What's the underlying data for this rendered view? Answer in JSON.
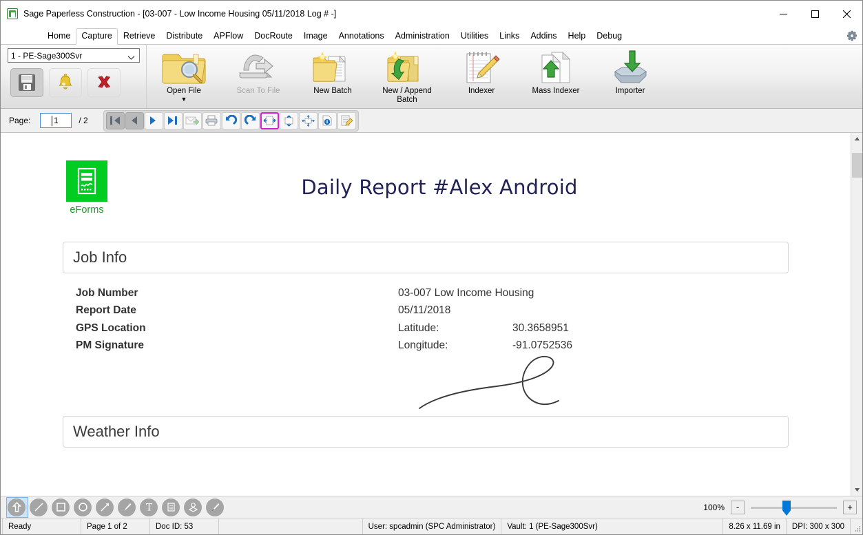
{
  "window": {
    "title": "Sage Paperless Construction - [03-007 - Low Income Housing 05/11/2018 Log # -]",
    "minimize_label": "—",
    "maximize_label": "☐",
    "close_label": "✕"
  },
  "menu": {
    "items": [
      {
        "label": "Home",
        "active": false
      },
      {
        "label": "Capture",
        "active": true
      },
      {
        "label": "Retrieve",
        "active": false
      },
      {
        "label": "Distribute",
        "active": false
      },
      {
        "label": "APFlow",
        "active": false
      },
      {
        "label": "DocRoute",
        "active": false
      },
      {
        "label": "Image",
        "active": false
      },
      {
        "label": "Annotations",
        "active": false
      },
      {
        "label": "Administration",
        "active": false
      },
      {
        "label": "Utilities",
        "active": false
      },
      {
        "label": "Links",
        "active": false
      },
      {
        "label": "Addins",
        "active": false
      },
      {
        "label": "Help",
        "active": false
      },
      {
        "label": "Debug",
        "active": false
      }
    ],
    "settings_icon": "gear-icon"
  },
  "ribbon": {
    "vault_value": "1 - PE-Sage300Svr",
    "quick_buttons": [
      {
        "name": "save-button",
        "icon": "floppy-disk-icon",
        "state": "pressed"
      },
      {
        "name": "notify-button",
        "icon": "bell-icon",
        "state": "normal"
      },
      {
        "name": "cancel-button",
        "icon": "red-x-icon",
        "state": "normal"
      }
    ],
    "items": [
      {
        "label": "Open File",
        "icon": "folder-search-icon",
        "disabled": false,
        "dropdown": true
      },
      {
        "label": "Scan To File",
        "icon": "scanner-icon",
        "disabled": true,
        "dropdown": false
      },
      {
        "label": "New Batch",
        "icon": "new-batch-folder-icon",
        "disabled": false,
        "dropdown": false
      },
      {
        "label": "New / Append\nBatch",
        "icon": "append-batch-folder-icon",
        "disabled": false,
        "dropdown": false
      },
      {
        "label": "Indexer",
        "icon": "notepad-pencil-icon",
        "disabled": false,
        "dropdown": false
      },
      {
        "label": "Mass Indexer",
        "icon": "document-up-arrow-icon",
        "disabled": false,
        "dropdown": false
      },
      {
        "label": "Importer",
        "icon": "import-tray-icon",
        "disabled": false,
        "dropdown": false
      }
    ]
  },
  "navbar": {
    "page_label": "Page:",
    "page_value": "1",
    "page_total": "/ 2",
    "buttons": [
      {
        "name": "first-page-button",
        "icon": "first-page-icon",
        "state": "grey"
      },
      {
        "name": "previous-page-button",
        "icon": "previous-page-icon",
        "state": "grey"
      },
      {
        "name": "next-page-button",
        "icon": "next-page-icon",
        "state": "normal"
      },
      {
        "name": "last-page-button",
        "icon": "last-page-icon",
        "state": "normal"
      },
      {
        "name": "email-button",
        "icon": "email-send-icon",
        "state": "dim"
      },
      {
        "name": "print-button",
        "icon": "printer-icon",
        "state": "normal"
      },
      {
        "name": "rotate-left-button",
        "icon": "rotate-left-icon",
        "state": "normal"
      },
      {
        "name": "rotate-right-button",
        "icon": "rotate-right-icon",
        "state": "normal"
      },
      {
        "name": "fit-width-button",
        "icon": "fit-width-icon",
        "state": "selected"
      },
      {
        "name": "fit-height-button",
        "icon": "fit-height-icon",
        "state": "normal"
      },
      {
        "name": "fit-page-button",
        "icon": "fit-page-icon",
        "state": "normal"
      },
      {
        "name": "document-info-button",
        "icon": "info-icon",
        "state": "normal"
      },
      {
        "name": "edit-document-button",
        "icon": "document-pencil-icon",
        "state": "normal"
      }
    ]
  },
  "document": {
    "logo_label": "eForms",
    "logo_icon": "eforms-document-icon",
    "title": "Daily Report #Alex Android",
    "sections": [
      {
        "heading": "Job Info"
      },
      {
        "heading": "Weather Info"
      }
    ],
    "job_info": {
      "labels": [
        "Job Number",
        "Report Date",
        "GPS Location",
        "",
        "PM Signature"
      ],
      "values": [
        {
          "key": "",
          "value": "03-007 Low Income Housing"
        },
        {
          "key": "",
          "value": "05/11/2018"
        },
        {
          "key": "Latitude:",
          "value": "30.3658951"
        },
        {
          "key": "Longitude:",
          "value": "-91.0752536"
        }
      ]
    },
    "signature_alt": "handwritten-signature"
  },
  "annotations": {
    "tools": [
      {
        "name": "select-tool",
        "icon": "up-arrow-icon",
        "selected": true
      },
      {
        "name": "line-tool",
        "icon": "line-icon",
        "selected": false
      },
      {
        "name": "rectangle-tool",
        "icon": "square-icon",
        "selected": false
      },
      {
        "name": "ellipse-tool",
        "icon": "circle-icon",
        "selected": false
      },
      {
        "name": "arrow-tool",
        "icon": "arrow-icon",
        "selected": false
      },
      {
        "name": "highlighter-tool",
        "icon": "pen-icon",
        "selected": false
      },
      {
        "name": "text-tool",
        "icon": "text-t-icon",
        "selected": false
      },
      {
        "name": "note-tool",
        "icon": "lined-note-icon",
        "selected": false
      },
      {
        "name": "stamp-tool",
        "icon": "stamp-icon",
        "selected": false
      },
      {
        "name": "brush-tool",
        "icon": "brush-icon",
        "selected": false
      }
    ]
  },
  "zoom": {
    "level": "100%",
    "minus_label": "-",
    "plus_label": "+"
  },
  "statusbar": {
    "ready": "Ready",
    "page": "Page 1 of 2",
    "doc_id": "Doc ID: 53",
    "spacer": "",
    "user": "User: spcadmin (SPC Administrator)",
    "vault": "Vault: 1 (PE-Sage300Svr)",
    "size": "8.26 x 11.69 in",
    "dpi": "DPI: 300 x 300"
  },
  "colors": {
    "accent": "#0078d7",
    "eforms_green": "#00cc22",
    "title_navy": "#222257",
    "selected_magenta": "#d321d3"
  }
}
